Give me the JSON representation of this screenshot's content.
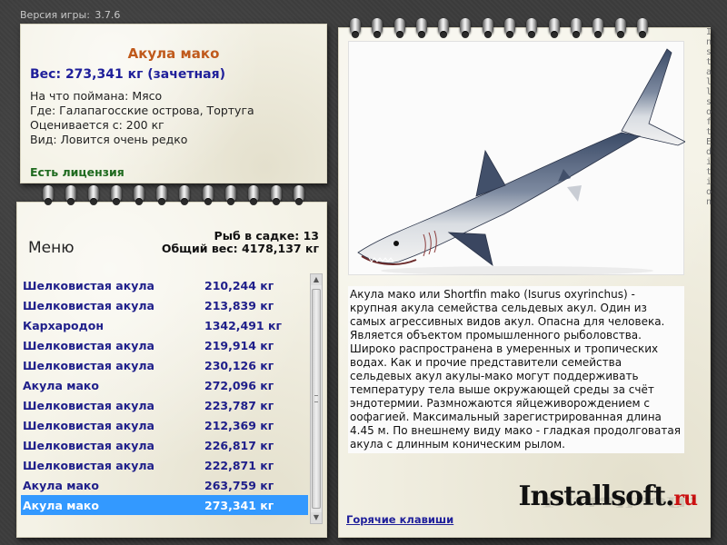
{
  "version": {
    "label": "Версия игры:",
    "number": "3.7.6"
  },
  "info": {
    "fish_name": "Акула мако",
    "weight_line": "Вес: 273,341 кг (зачетная)",
    "caught_on": "На что поймана: Мясо",
    "location": "Где: Галапагосские острова, Тортуга",
    "valued_from": "Оценивается с: 200 кг",
    "kind": "Вид: Ловится очень редко",
    "license": "Есть лицензия"
  },
  "list_panel": {
    "menu": "Меню",
    "fish_count": "Рыб в садке: 13",
    "total_weight": "Общий вес: 4178,137 кг",
    "selected_index": 11,
    "fish": [
      {
        "name": "Шелковистая акула",
        "weight": "210,244 кг"
      },
      {
        "name": "Шелковистая акула",
        "weight": "213,839 кг"
      },
      {
        "name": "Кархародон",
        "weight": "1342,491 кг"
      },
      {
        "name": "Шелковистая акула",
        "weight": "219,914 кг"
      },
      {
        "name": "Шелковистая акула",
        "weight": "230,126 кг"
      },
      {
        "name": "Акула мако",
        "weight": "272,096 кг"
      },
      {
        "name": "Шелковистая акула",
        "weight": "223,787 кг"
      },
      {
        "name": "Шелковистая акула",
        "weight": "212,369 кг"
      },
      {
        "name": "Шелковистая акула",
        "weight": "226,817 кг"
      },
      {
        "name": "Шелковистая акула",
        "weight": "222,871 кг"
      },
      {
        "name": "Акула мако",
        "weight": "263,759 кг"
      },
      {
        "name": "Акула мако",
        "weight": "273,341 кг"
      }
    ]
  },
  "right_panel": {
    "description": "Акула мако или Shortfin mako (Isurus oxyrinchus) - крупная акула семейства сельдевых акул. Один из самых агрессивных видов акул. Опасна для человека. Является объектом промышленного рыболовства. Широко распространена в умеренных и тропических водах. Как и прочие представители семейства сельдевых акул акулы-мако могут поддерживать температуру тела выше окружающей среды за счёт эндотермии. Размножаются яйцеживорождением с оофагией. Максимальный зарегистрированная длина 4.45 м. По внешнему виду мако - гладкая продолговатая акула с длинным коническим рылом.",
    "brand_main": "Installsoft.",
    "brand_tld": "ru",
    "hotkeys": "Горячие клавиши",
    "side_text": "InstallsoftEdition"
  },
  "colors": {
    "selection": "#3399ff",
    "title_orange": "#c05a1c",
    "weight_blue": "#1f1f9a",
    "license_green": "#1f6a1f",
    "brand_red": "#cc1111"
  }
}
